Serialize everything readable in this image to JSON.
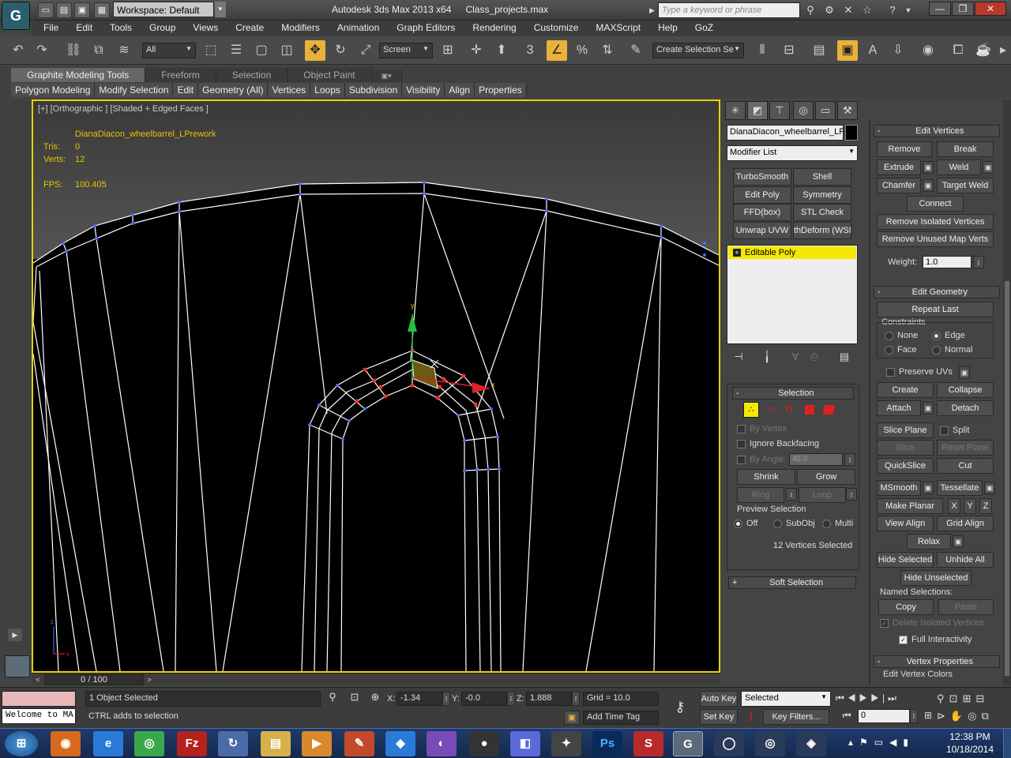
{
  "titlebar": {
    "app_logo": "G",
    "workspace": "Workspace: Default",
    "app_name": "Autodesk 3ds Max  2013 x64",
    "file_name": "Class_projects.max",
    "search_placeholder": "Type a keyword or phrase"
  },
  "menu": [
    "File",
    "Edit",
    "Tools",
    "Group",
    "Views",
    "Create",
    "Modifiers",
    "Animation",
    "Graph Editors",
    "Rendering",
    "Customize",
    "MAXScript",
    "Help",
    "GoZ"
  ],
  "toolbar": {
    "selection_filter": "All",
    "ref_coord": "Screen",
    "named_selection": "Create Selection Se"
  },
  "ribbon": {
    "tabs": [
      "Graphite Modeling Tools",
      "Freeform",
      "Selection",
      "Object Paint"
    ],
    "panels": [
      "Polygon Modeling",
      "Modify Selection",
      "Edit",
      "Geometry (All)",
      "Vertices",
      "Loops",
      "Subdivision",
      "Visibility",
      "Align",
      "Properties"
    ]
  },
  "viewport": {
    "label": "[+] [Orthographic ] [Shaded + Edged Faces ]",
    "object_name": "DianaDiacon_wheelbarrel_LPrework",
    "tris_label": "Tris:",
    "tris": "0",
    "verts_label": "Verts:",
    "verts": "12",
    "fps_label": "FPS:",
    "fps": "100.405"
  },
  "timeline": {
    "slider": "0 / 100"
  },
  "modify_panel": {
    "object_name": "DianaDiacon_wheelbarrel_LPr",
    "modifier_list": "Modifier List",
    "mod_buttons": [
      "TurboSmooth",
      "Shell",
      "Edit Poly",
      "Symmetry",
      "FFD(box)",
      "STL Check",
      "Unwrap UVW",
      "thDeform (WSI"
    ],
    "stack_item": "Editable Poly",
    "selection": {
      "title": "Selection",
      "by_vertex": "By Vertex",
      "ignore_backfacing": "Ignore Backfacing",
      "by_angle": "By Angle:",
      "angle_value": "45.0",
      "shrink": "Shrink",
      "grow": "Grow",
      "ring": "Ring",
      "loop": "Loop",
      "preview_label": "Preview Selection",
      "preview_off": "Off",
      "preview_subobj": "SubObj",
      "preview_multi": "Multi",
      "status": "12 Vertices Selected"
    },
    "soft_selection": "Soft Selection"
  },
  "edit_vertices": {
    "title": "Edit Vertices",
    "remove": "Remove",
    "break": "Break",
    "extrude": "Extrude",
    "weld": "Weld",
    "chamfer": "Chamfer",
    "target_weld": "Target Weld",
    "connect": "Connect",
    "remove_isolated": "Remove Isolated Vertices",
    "remove_unused": "Remove Unused Map Verts",
    "weight_label": "Weight:",
    "weight": "1.0"
  },
  "edit_geometry": {
    "title": "Edit Geometry",
    "repeat_last": "Repeat Last",
    "constraints": "Constraints",
    "none": "None",
    "edge": "Edge",
    "face": "Face",
    "normal": "Normal",
    "preserve_uvs": "Preserve UVs",
    "create": "Create",
    "collapse": "Collapse",
    "attach": "Attach",
    "detach": "Detach",
    "slice_plane": "Slice Plane",
    "split": "Split",
    "slice": "Slice",
    "reset_plane": "Reset Plane",
    "quickslice": "QuickSlice",
    "cut": "Cut",
    "msmooth": "MSmooth",
    "tessellate": "Tessellate",
    "make_planar": "Make Planar",
    "x": "X",
    "y": "Y",
    "z": "Z",
    "view_align": "View Align",
    "grid_align": "Grid Align",
    "relax": "Relax",
    "hide_selected": "Hide Selected",
    "unhide_all": "Unhide All",
    "hide_unselected": "Hide Unselected",
    "named_selections": "Named Selections:",
    "copy": "Copy",
    "paste": "Paste",
    "delete_isolated": "Delete Isolated Vertices",
    "full_interactivity": "Full Interactivity"
  },
  "vertex_properties": {
    "title": "Vertex Properties",
    "edit_colors": "Edit Vertex Colors"
  },
  "status": {
    "maxscript": "Welcome to MA",
    "selection": "1 Object Selected",
    "prompt": "CTRL adds to selection",
    "x_label": "X:",
    "x": "-1.34",
    "y_label": "Y:",
    "y": "-0.0",
    "z_label": "Z:",
    "z": "1.888",
    "grid": "Grid = 10.0",
    "add_time_tag": "Add Time Tag",
    "auto_key": "Auto Key",
    "set_key": "Set Key",
    "key_mode": "Selected",
    "key_filters": "Key Filters...",
    "frame": "0"
  },
  "taskbar": {
    "time": "12:38 PM",
    "date": "10/18/2014",
    "apps": [
      "start-orb",
      "firefox",
      "internet-explorer",
      "chrome",
      "filezilla",
      "refresh-app",
      "file-explorer",
      "media-player",
      "paint-app",
      "dropbox",
      "app-purple",
      "app-dark",
      "app-blue",
      "figure-app",
      "photoshop",
      "app-red",
      "3dsmax",
      "app-circle",
      "app-lens",
      "app-diamond"
    ]
  },
  "colors": {
    "viewport_border": "#e8d200",
    "stat_text": "#e8c200",
    "selected_vertex": "#ff2a2a",
    "gizmo_x": "#e02020",
    "gizmo_y": "#20c040",
    "stack_highlight": "#f5e800"
  }
}
